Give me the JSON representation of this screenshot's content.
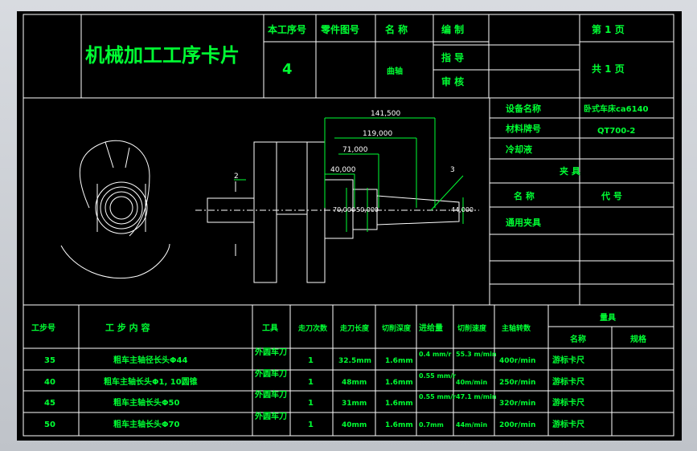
{
  "title": "机械加工工序卡片",
  "header": {
    "process_no_label": "本工序号",
    "part_drawing_label": "零件图号",
    "name_label": "名  称",
    "prepared_label": "编  制",
    "page_label": "第  1  页",
    "guide_label": "指  导",
    "review_label": "审  核",
    "total_label": "共  1  页",
    "process_no_value": "4",
    "part_name_value": "曲轴"
  },
  "info": {
    "equipment_label": "设备名称",
    "equipment_value": "卧式车床ca6140",
    "material_label": "材料牌号",
    "material_value": "QT700-2",
    "coolant_label": "冷却液",
    "fixture_label": "夹  具",
    "fixture_name_label": "名  称",
    "fixture_code_label": "代  号",
    "fixture_name_value": "通用夹具"
  },
  "drawing": {
    "dims": [
      "141,500",
      "119,000",
      "71,000",
      "40,000",
      "2",
      "3",
      "70,000",
      "50,000",
      "44,000"
    ]
  },
  "table": {
    "headers": {
      "step_no": "工步号",
      "content": "工  步  内  容",
      "tool": "工具",
      "passes": "走刀次数",
      "length": "走刀长度",
      "depth": "切削深度",
      "feed": "进给量",
      "speed": "切削速度",
      "spindle": "主轴转数",
      "gauge": "量具",
      "gauge_name": "名称",
      "gauge_spec": "规格"
    },
    "rows": [
      {
        "no": "35",
        "content": "粗车主轴径长头Φ44",
        "tool": "外圆车刀",
        "passes": "1",
        "length": "32.5mm",
        "depth": "1.6mm",
        "feed": "0.4 mm/r",
        "speed": "55.3 m/min",
        "spindle": "400r/min",
        "gauge": "游标卡尺"
      },
      {
        "no": "40",
        "content": "粗车主轴长头Φ1, 10圆锥",
        "tool": "外圆车刀",
        "passes": "1",
        "length": "48mm",
        "depth": "1.6mm",
        "feed": "0.55 mm/r",
        "speed": "40m/min",
        "spindle": "250r/min",
        "gauge": "游标卡尺"
      },
      {
        "no": "45",
        "content": "粗车主轴长头Φ50",
        "tool": "外圆车刀",
        "passes": "1",
        "length": "31mm",
        "depth": "1.6mm",
        "feed": "0.55 mm/r",
        "speed": "47.1 m/min",
        "spindle": "320r/min",
        "gauge": "游标卡尺"
      },
      {
        "no": "50",
        "content": "粗车主轴长头Φ70",
        "tool": "外圆车刀",
        "passes": "1",
        "length": "40mm",
        "depth": "1.6mm",
        "feed": "0.7mm",
        "speed": "44m/min",
        "spindle": "200r/min",
        "gauge": "游标卡尺"
      }
    ]
  }
}
